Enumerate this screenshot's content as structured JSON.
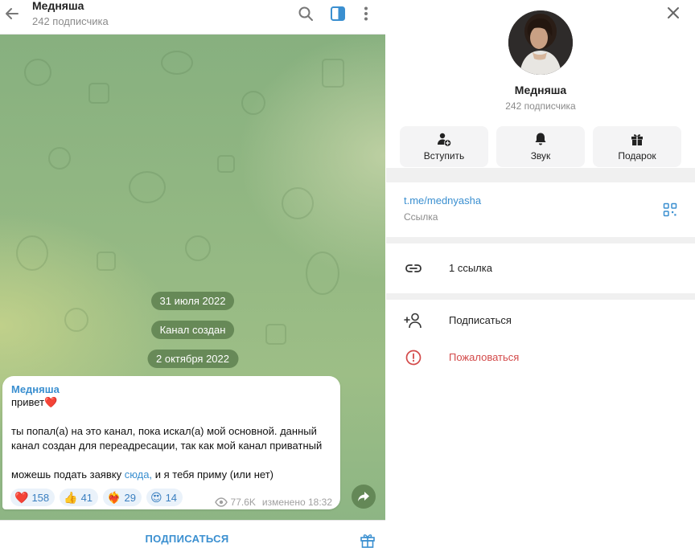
{
  "header": {
    "title": "Медняша",
    "subtitle": "242 подписчика"
  },
  "chat": {
    "date_pills": [
      "31 июля 2022",
      "Канал создан",
      "2 октября 2022"
    ],
    "message": {
      "author": "Медняша",
      "lines": [
        "привет",
        "",
        "ты попал(а) на это канал, пока искал(а) мой основной. данный",
        "канал создан для переадресации, так как мой канал приватный",
        "",
        "можешь подать заявку"
      ],
      "link_text": "сюда,",
      "after_link": " и я тебя приму (или нет)",
      "reactions": [
        {
          "emoji": "❤️",
          "count": "158"
        },
        {
          "emoji": "👍",
          "count": "41"
        },
        {
          "emoji": "❤️‍🔥",
          "count": "29"
        },
        {
          "emoji": "😍",
          "count": "14"
        }
      ],
      "views": "77.6K",
      "edited_time": "изменено 18:32"
    },
    "footer_button": "ПОДПИСАТЬСЯ"
  },
  "info": {
    "name": "Медняша",
    "subtitle": "242 подписчика",
    "actions": [
      {
        "label": "Вступить",
        "icon": "join-icon"
      },
      {
        "label": "Звук",
        "icon": "bell-icon"
      },
      {
        "label": "Подарок",
        "icon": "gift-icon"
      }
    ],
    "link": "t.me/mednyasha",
    "link_caption": "Ссылка",
    "links_count": "1 ссылка",
    "subscribe": "Подписаться",
    "report": "Пожаловаться"
  },
  "colors": {
    "accent": "#3a8fd0",
    "danger": "#d34a4a",
    "pill_bg": "#567848"
  }
}
